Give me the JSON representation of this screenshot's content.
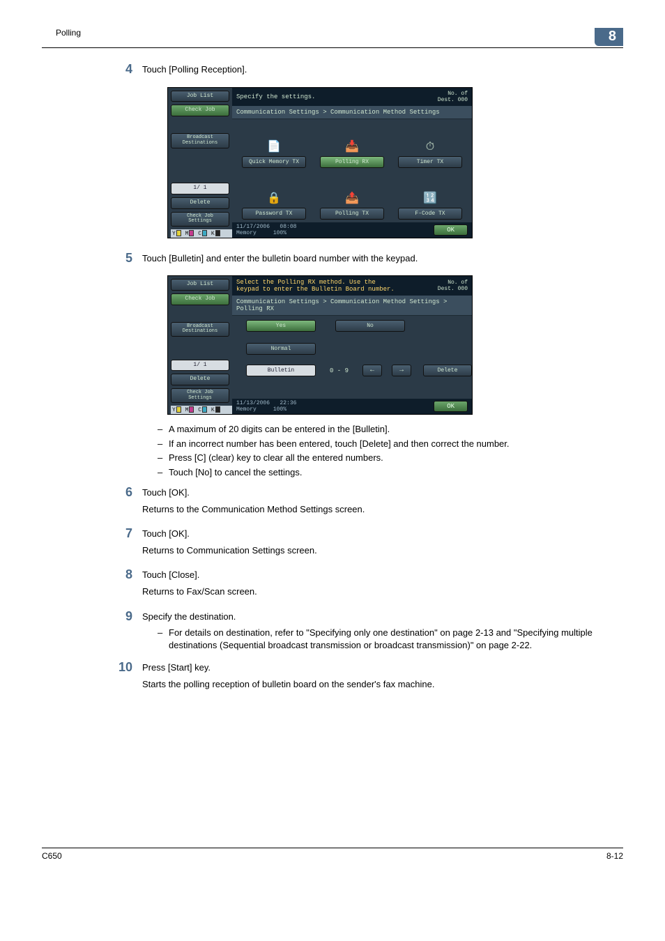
{
  "header": {
    "left": "Polling",
    "chapter": "8"
  },
  "steps": {
    "s4": {
      "num": "4",
      "text": "Touch [Polling Reception]."
    },
    "s5": {
      "num": "5",
      "text": "Touch [Bulletin] and enter the bulletin board number with the keypad.",
      "bullets": [
        "A maximum of 20 digits can be entered in the [Bulletin].",
        "If an incorrect number has been entered, touch [Delete] and then correct the number.",
        "Press [C] (clear) key to clear all the entered numbers.",
        "Touch [No] to cancel the settings."
      ]
    },
    "s6": {
      "num": "6",
      "text": "Touch [OK].",
      "after": "Returns to the Communication Method Settings screen."
    },
    "s7": {
      "num": "7",
      "text": "Touch [OK].",
      "after": "Returns to Communication Settings screen."
    },
    "s8": {
      "num": "8",
      "text": "Touch [Close].",
      "after": "Returns to Fax/Scan screen."
    },
    "s9": {
      "num": "9",
      "text": "Specify the destination.",
      "bullets": [
        "For details on destination, refer to \"Specifying only one destination\" on page 2-13 and \"Specifying multiple destinations (Sequential broadcast transmission or broadcast transmission)\" on page 2-22."
      ]
    },
    "s10": {
      "num": "10",
      "text": "Press [Start] key.",
      "after": "Starts the polling reception of bulletin board on the sender's fax machine."
    }
  },
  "panel1": {
    "title": "Specify the settings.",
    "dest_label": "No. of\nDest.",
    "dest_count": "000",
    "crumb": "Communication Settings > Communication Method Settings",
    "sidebar": {
      "job_list": "Job List",
      "check_job": "Check Job",
      "broadcast": "Broadcast\nDestinations",
      "page": "1/  1",
      "delete": "Delete",
      "check_settings": "Check Job\nSettings"
    },
    "options": {
      "a": "Quick Memory TX",
      "b": "Polling RX",
      "c": "Timer TX",
      "d": "Password TX",
      "e": "Polling TX",
      "f": "F-Code TX"
    },
    "footer": {
      "date": "11/17/2006",
      "time": "08:08",
      "mem": "Memory",
      "pct": "100%",
      "ok": "OK"
    }
  },
  "panel2": {
    "title": "Select the Polling RX method. Use the\nkeypad to enter the Bulletin Board number.",
    "dest_label": "No. of\nDest.",
    "dest_count": "000",
    "crumb": "Communication Settings > Communication Method Settings > Polling RX",
    "yes": "Yes",
    "no": "No",
    "normal": "Normal",
    "bulletin": "Bulletin",
    "range": "0 - 9",
    "left": "←",
    "right": "→",
    "delete": "Delete",
    "footer": {
      "date": "11/13/2006",
      "time": "22:36",
      "mem": "Memory",
      "pct": "100%",
      "ok": "OK"
    }
  },
  "footer": {
    "left": "C650",
    "right": "8-12"
  }
}
